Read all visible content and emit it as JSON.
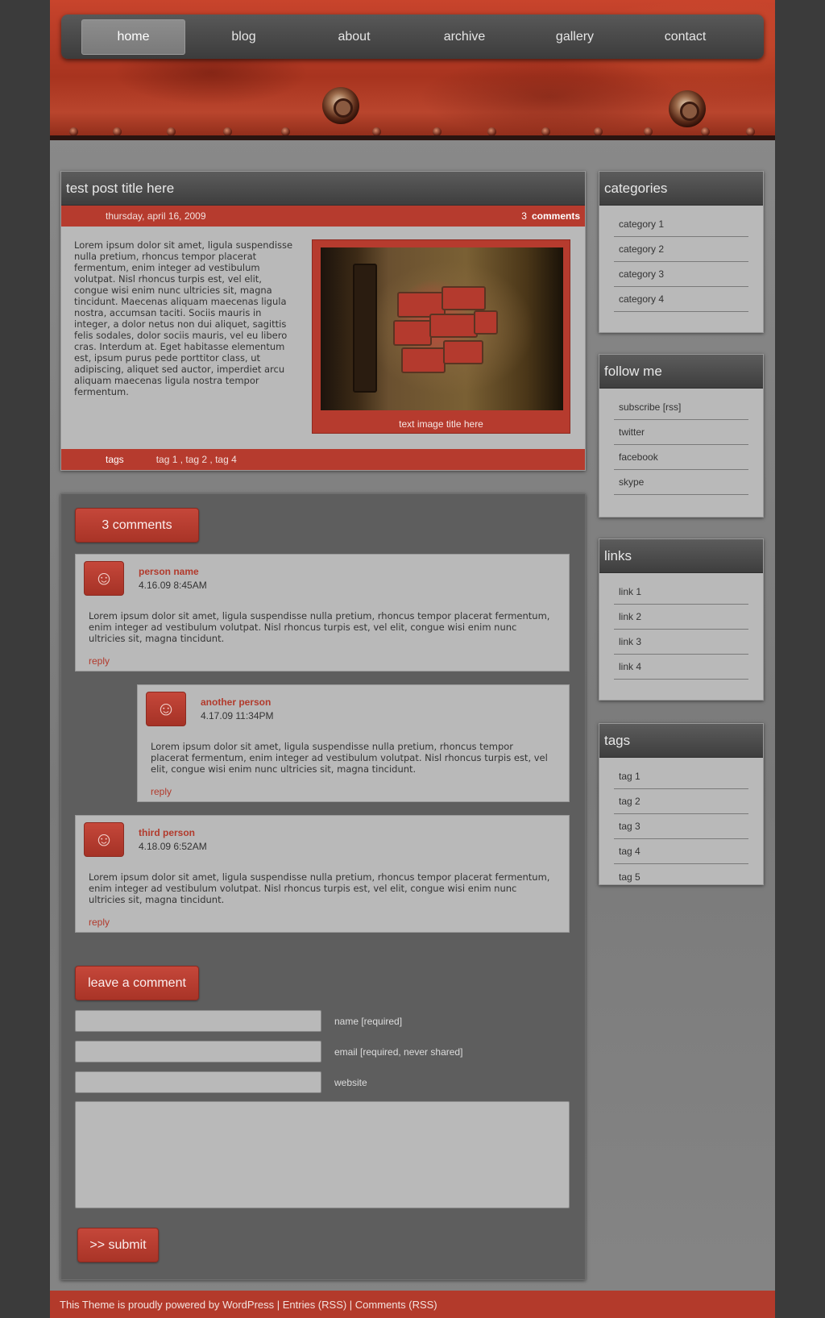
{
  "nav": {
    "items": [
      "home",
      "blog",
      "about",
      "archive",
      "gallery",
      "contact"
    ]
  },
  "post": {
    "title": "test post title here",
    "date": "thursday, april 16, 2009",
    "comment_count": "3",
    "comment_label": "comments",
    "body": "Lorem ipsum dolor sit amet, ligula suspendisse nulla pretium, rhoncus tempor placerat fermentum, enim integer ad vestibulum volutpat. Nisl rhoncus turpis est, vel elit, congue wisi enim nunc ultricies sit, magna tincidunt. Maecenas aliquam maecenas ligula nostra, accumsan taciti. Sociis mauris in integer, a dolor netus non dui aliquet, sagittis felis sodales, dolor sociis mauris, vel eu libero cras. Interdum at. Eget habitasse elementum est, ipsum purus pede porttitor class, ut adipiscing, aliquet sed auctor, imperdiet arcu aliquam maecenas ligula nostra tempor fermentum.",
    "image_caption": "text image title here",
    "tags_label": "tags",
    "tags": "tag 1 , tag 2 , tag 4"
  },
  "comments": {
    "heading": "3 comments",
    "items": [
      {
        "author": "person name",
        "date": "4.16.09  8:45AM",
        "text": "Lorem ipsum dolor sit amet, ligula suspendisse nulla pretium, rhoncus tempor placerat fermentum, enim integer ad vestibulum volutpat. Nisl rhoncus turpis est, vel elit, congue wisi enim nunc ultricies sit, magna tincidunt.",
        "reply": "reply"
      },
      {
        "author": "another person",
        "date": "4.17.09  11:34PM",
        "text": "Lorem ipsum dolor sit amet, ligula suspendisse nulla pretium, rhoncus tempor placerat fermentum, enim integer ad vestibulum volutpat. Nisl rhoncus turpis est, vel elit, congue wisi enim nunc ultricies sit, magna tincidunt.",
        "reply": "reply"
      },
      {
        "author": "third person",
        "date": "4.18.09  6:52AM",
        "text": "Lorem ipsum dolor sit amet, ligula suspendisse nulla pretium, rhoncus tempor placerat fermentum, enim integer ad vestibulum volutpat. Nisl rhoncus turpis est, vel elit, congue wisi enim nunc ultricies sit, magna tincidunt.",
        "reply": "reply"
      }
    ],
    "avatar_glyph": "☺"
  },
  "form": {
    "heading": "leave a comment",
    "name_label": "name  [required]",
    "email_label": "email  [required, never shared]",
    "website_label": "website",
    "submit": ">> submit"
  },
  "sidebar": {
    "categories": {
      "title": "categories",
      "items": [
        "category 1",
        "category 2",
        "category 3",
        "category 4"
      ]
    },
    "follow": {
      "title": "follow me",
      "items": [
        "subscribe [rss]",
        "twitter",
        "facebook",
        "skype"
      ]
    },
    "links": {
      "title": "links",
      "items": [
        "link 1",
        "link 2",
        "link 3",
        "link 4"
      ]
    },
    "tags": {
      "title": "tags",
      "items": [
        "tag 1",
        "tag 2",
        "tag 3",
        "tag 4",
        "tag 5"
      ]
    }
  },
  "footer": {
    "text": "This Theme is proudly powered by WordPress | Entries (RSS) | Comments (RSS)"
  },
  "colors": {
    "accent": "#b63b2e",
    "panel": "#b9b9b9",
    "dark": "#3b3b3b"
  }
}
